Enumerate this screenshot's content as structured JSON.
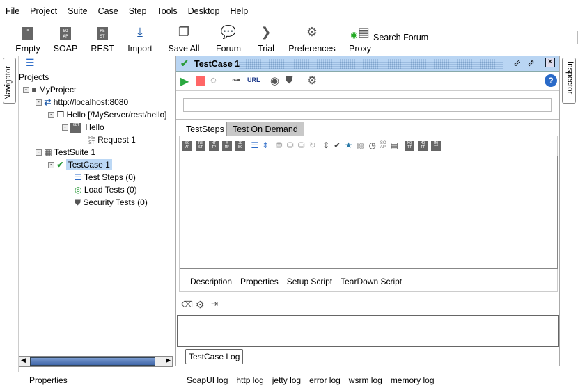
{
  "menu": [
    "File",
    "Project",
    "Suite",
    "Case",
    "Step",
    "Tools",
    "Desktop",
    "Help"
  ],
  "toolbar": [
    {
      "label": "Empty",
      "icon": "empty-project-icon"
    },
    {
      "label": "SOAP",
      "icon": "soap-icon"
    },
    {
      "label": "REST",
      "icon": "rest-icon"
    },
    {
      "label": "Import",
      "icon": "import-icon"
    },
    {
      "label": "Save All",
      "icon": "save-all-icon"
    },
    {
      "label": "Forum",
      "icon": "forum-icon"
    },
    {
      "label": "Trial",
      "icon": "trial-icon"
    },
    {
      "label": "Preferences",
      "icon": "gear-icon"
    },
    {
      "label": "Proxy",
      "icon": "proxy-icon"
    }
  ],
  "search": {
    "label": "Search Forum",
    "value": ""
  },
  "navigator": {
    "tab": "Navigator",
    "root": "Projects",
    "tree": [
      "MyProject",
      "http://localhost:8080",
      "Hello [/MyServer/rest/hello]",
      "Hello",
      "Request 1",
      "TestSuite 1",
      "TestCase 1",
      "Test Steps (0)",
      "Load Tests (0)",
      "Security Tests (0)"
    ],
    "properties": "Properties"
  },
  "inspector": {
    "tab": "Inspector"
  },
  "testcase": {
    "title": "TestCase 1",
    "url_label": "URL",
    "tabs": [
      "TestSteps",
      "Test On Demand"
    ],
    "bottom_tabs": [
      "Description",
      "Properties",
      "Setup Script",
      "TearDown Script"
    ],
    "log_button": "TestCase Log",
    "accent": "#b9d5f3"
  },
  "logs": [
    "SoapUI log",
    "http log",
    "jetty log",
    "error log",
    "wsrm log",
    "memory log"
  ]
}
